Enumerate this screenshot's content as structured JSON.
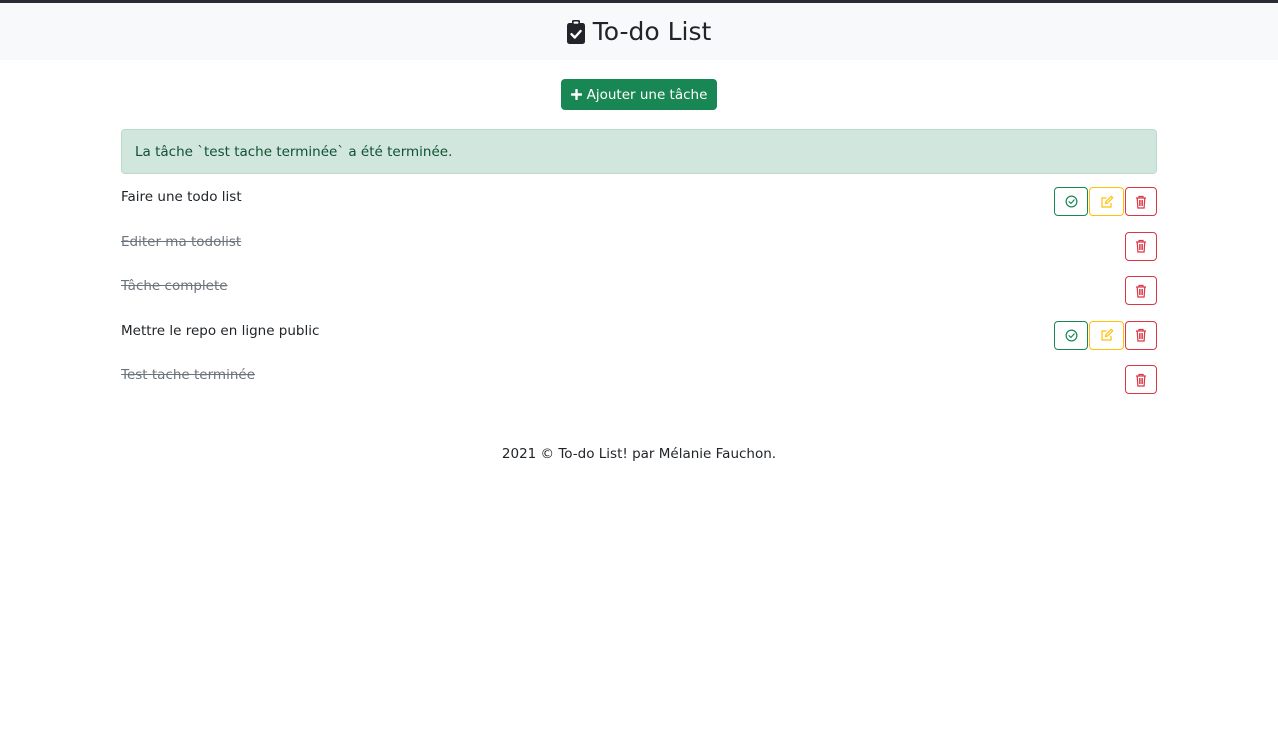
{
  "header": {
    "title": "To-do List",
    "icon": "clipboard-check-icon"
  },
  "toolbar": {
    "add_label": "Ajouter une tâche",
    "add_icon": "plus-icon"
  },
  "alert": {
    "message": "La tâche `test tache terminée` a été terminée."
  },
  "tasks": [
    {
      "label": "Faire une todo list",
      "done": false
    },
    {
      "label": "Editer ma todolist",
      "done": true
    },
    {
      "label": "Tâche complete",
      "done": true
    },
    {
      "label": "Mettre le repo en ligne public",
      "done": false
    },
    {
      "label": "Test tache terminée",
      "done": true
    }
  ],
  "footer": {
    "text": "2021 © To-do List! par Mélanie Fauchon."
  },
  "colors": {
    "success": "#198754",
    "warning": "#ffc107",
    "danger": "#dc3545",
    "alert_bg": "#d1e7dd",
    "header_bg": "#f8f9fa"
  }
}
